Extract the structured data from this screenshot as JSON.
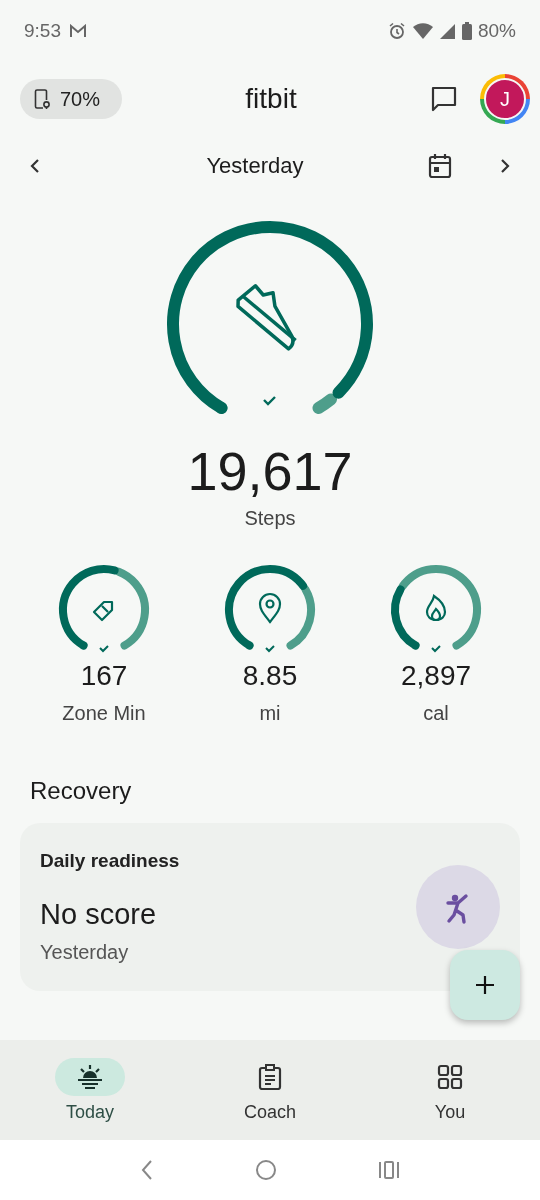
{
  "status_bar": {
    "time": "9:53",
    "battery": "80%"
  },
  "header": {
    "device_battery": "70%",
    "title": "fitbit",
    "avatar_letter": "J"
  },
  "date_nav": {
    "label": "Yesterday"
  },
  "steps": {
    "value": "19,617",
    "label": "Steps",
    "goal_met": true
  },
  "stats": [
    {
      "kind": "zone",
      "value": "167",
      "label": "Zone Min",
      "goal_met": true
    },
    {
      "kind": "distance",
      "value": "8.85",
      "label": "mi",
      "goal_met": true
    },
    {
      "kind": "calories",
      "value": "2,897",
      "label": "cal",
      "goal_met": true
    }
  ],
  "recovery": {
    "title": "Recovery",
    "card": {
      "title": "Daily readiness",
      "score": "No score",
      "date": "Yesterday"
    }
  },
  "tabs": [
    {
      "kind": "today",
      "label": "Today",
      "selected": true
    },
    {
      "kind": "coach",
      "label": "Coach",
      "selected": false
    },
    {
      "kind": "you",
      "label": "You",
      "selected": false
    }
  ]
}
